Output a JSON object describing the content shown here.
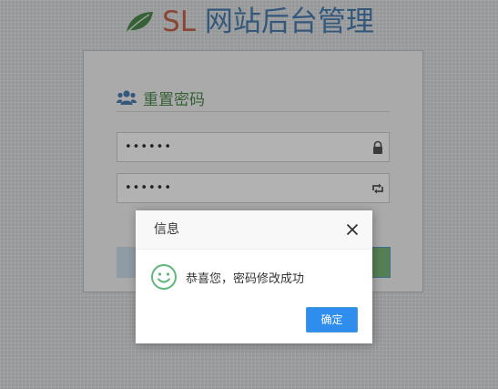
{
  "header": {
    "brand_short": "SL",
    "brand_rest": " 网站后台管理",
    "icon": "leaf-icon"
  },
  "panel": {
    "heading": "重置密码",
    "heading_icon": "users-icon",
    "fields": [
      {
        "value": "••••••",
        "icon": "lock-icon"
      },
      {
        "value": "••••••",
        "icon": "retweet-icon"
      }
    ]
  },
  "dialog": {
    "title": "信息",
    "message": "恭喜您，密码修改成功",
    "confirm_label": "确定",
    "icon": "smile-icon",
    "close_icon": "close-icon"
  },
  "colors": {
    "brand_sl": "#c8644c",
    "brand_rest": "#4a7fb0",
    "heading": "#4e8a4e",
    "confirm_button": "#2e8ded",
    "success_icon": "#5fb878"
  }
}
